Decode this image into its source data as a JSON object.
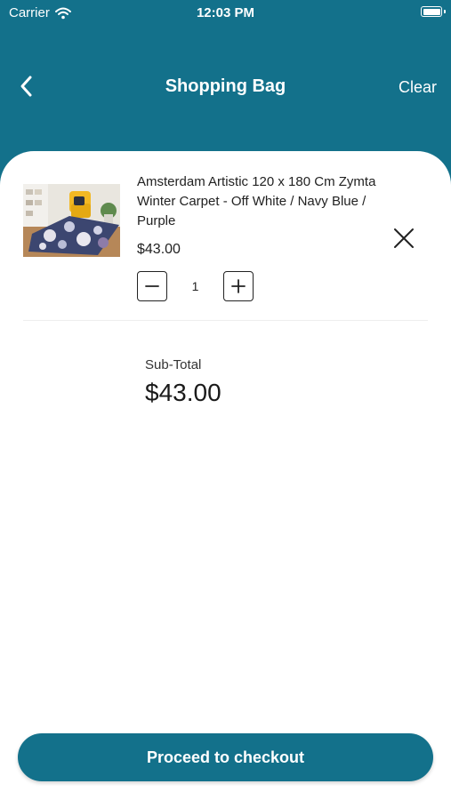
{
  "status_bar": {
    "carrier": "Carrier",
    "time": "12:03 PM"
  },
  "nav": {
    "title": "Shopping Bag",
    "clear_label": "Clear",
    "back_icon": "chevron-left-icon"
  },
  "cart": {
    "items": [
      {
        "name": "Amsterdam Artistic 120 x 180 Cm Zymta Winter Carpet - Off White / Navy Blue / Purple",
        "price": "$43.00",
        "quantity": "1"
      }
    ]
  },
  "summary": {
    "subtotal_label": "Sub-Total",
    "subtotal_value": "$43.00"
  },
  "checkout": {
    "label": "Proceed to checkout"
  },
  "colors": {
    "brand": "#13718b",
    "background": "#ffffff",
    "text": "#1a1a1a"
  }
}
